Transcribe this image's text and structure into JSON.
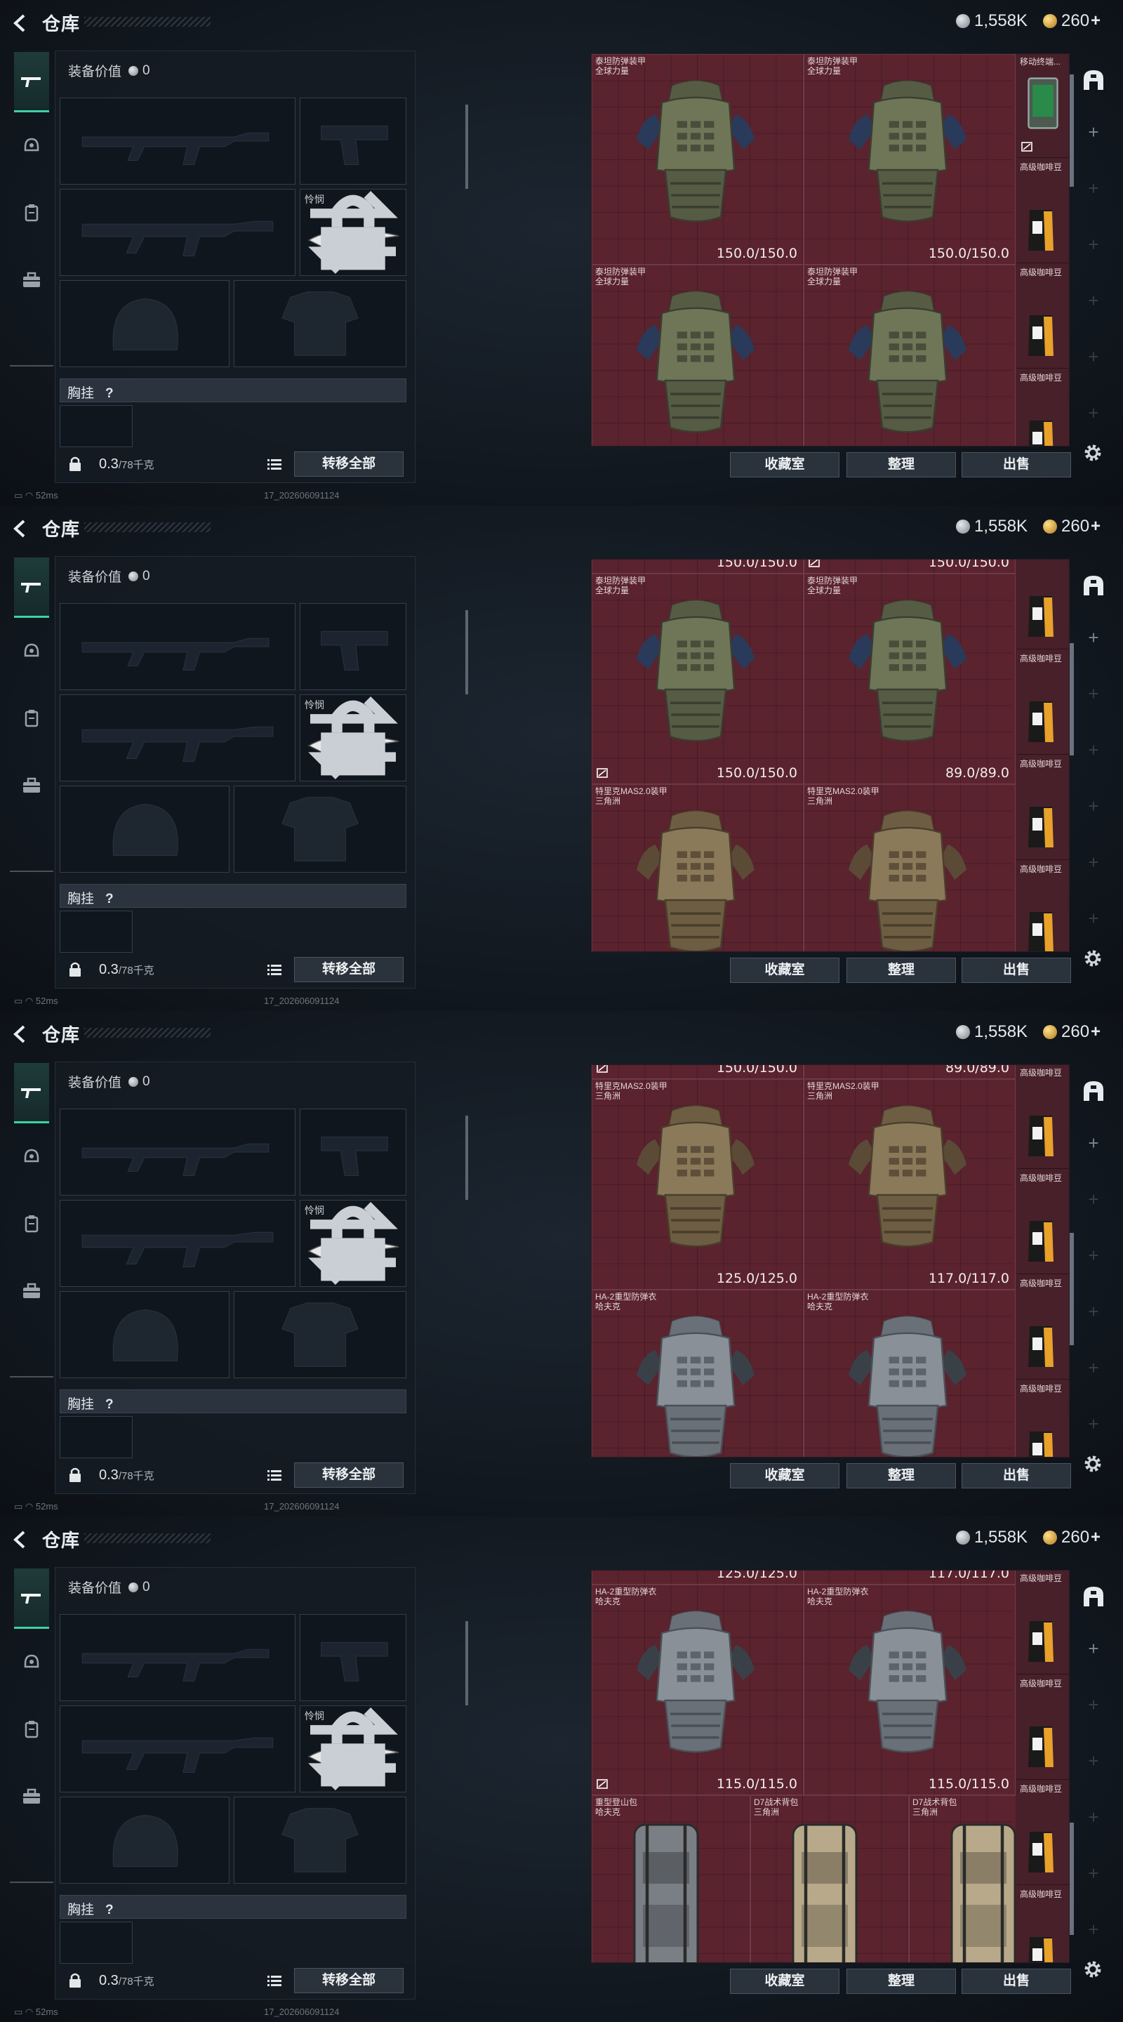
{
  "header": {
    "title": "仓库",
    "silver": "1,558K",
    "gold": "260",
    "gold_plus": "+"
  },
  "left": {
    "equip_value_label": "装备价值",
    "equip_value": "0",
    "melee_label": "怜悯",
    "section_label": "胸挂",
    "section_q": "?",
    "weight": "0.3",
    "weight_cap": "/78千克",
    "transfer_all": "转移全部"
  },
  "footer": {
    "vault": "收藏室",
    "sort": "整理",
    "sell": "出售"
  },
  "status": {
    "ping": "52ms",
    "build": "17_202606091124"
  },
  "colors": {
    "accent": "#3ed1a6",
    "grid_bg": "#5a232e"
  },
  "icons": [
    "back-icon",
    "rifle-icon",
    "helmet-icon",
    "backpack-icon",
    "case-icon",
    "lock-icon",
    "swap-icon",
    "list-icon",
    "settings-icon",
    "store-icon",
    "broken-icon"
  ],
  "items": {
    "armor1_l1": "泰坦防弹装甲",
    "armor1_l2": "全球力量",
    "armor2_l1": "特里克MAS2.0装甲",
    "armor2_l2": "三角洲",
    "armor3_l1": "HA-2重型防弹衣",
    "armor3_l2": "哈夫克",
    "bag1_l1": "重型登山包",
    "bag1_l2": "哈夫克",
    "bag2_l1": "D7战术背包",
    "bag2_l2": "三角洲",
    "terminal": "移动终端...",
    "coffee": "高级咖啡豆",
    "dur_150": "150.0/150.0",
    "dur_89": "89.0/89.0",
    "dur_125": "125.0/125.0",
    "dur_117": "117.0/117.0",
    "dur_115": "115.0/115.0"
  }
}
